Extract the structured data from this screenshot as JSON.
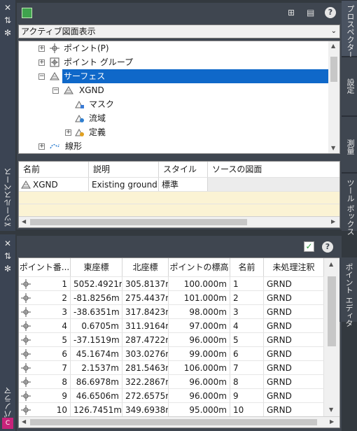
{
  "prospector": {
    "palette_label": "ツールスペース",
    "view_combo": "アクティブ図面表示",
    "tree": [
      {
        "label": "ポイント(P)",
        "icon": "point-icon"
      },
      {
        "label": "ポイント グループ",
        "icon": "point-group-icon"
      },
      {
        "label": "サーフェス",
        "icon": "surface-icon",
        "selected": true
      },
      {
        "label": "XGND",
        "icon": "surface-icon"
      },
      {
        "label": "マスク",
        "icon": "mask-icon"
      },
      {
        "label": "流域",
        "icon": "watershed-icon"
      },
      {
        "label": "定義",
        "icon": "definition-icon"
      },
      {
        "label": "線形",
        "icon": "alignment-icon"
      }
    ],
    "grid_headers": [
      "名前",
      "説明",
      "スタイル",
      "ソースの図面"
    ],
    "grid_row": {
      "name": "XGND",
      "desc": "Existing ground s",
      "style": "標準",
      "source": ""
    }
  },
  "side_tabs": [
    "プロスペクター",
    "設定",
    "測量",
    "ツール ボックス"
  ],
  "editor": {
    "palette_label": "パノラマ",
    "tab_label": "ポイント エディタ",
    "headers": [
      "ポイント番...",
      "東座標",
      "北座標",
      "ポイントの標高",
      "名前",
      "未処理注釈"
    ],
    "rows": [
      [
        "1",
        "5052.4921m",
        "305.8137m",
        "100.000m",
        "1",
        "GRND"
      ],
      [
        "2",
        "-81.8256m",
        "275.4437m",
        "101.000m",
        "2",
        "GRND"
      ],
      [
        "3",
        "-38.6351m",
        "317.8423m",
        "98.000m",
        "3",
        "GRND"
      ],
      [
        "4",
        "0.6705m",
        "311.9164m",
        "97.000m",
        "4",
        "GRND"
      ],
      [
        "5",
        "-37.1519m",
        "287.4722m",
        "96.000m",
        "5",
        "GRND"
      ],
      [
        "6",
        "45.1674m",
        "303.0276m",
        "99.000m",
        "6",
        "GRND"
      ],
      [
        "7",
        "2.1537m",
        "281.5463m",
        "106.000m",
        "7",
        "GRND"
      ],
      [
        "8",
        "86.6978m",
        "322.2867m",
        "96.000m",
        "8",
        "GRND"
      ],
      [
        "9",
        "46.6506m",
        "272.6575m",
        "96.000m",
        "9",
        "GRND"
      ],
      [
        "10",
        "126.7451m",
        "349.6938m",
        "95.000m",
        "10",
        "GRND"
      ]
    ]
  }
}
